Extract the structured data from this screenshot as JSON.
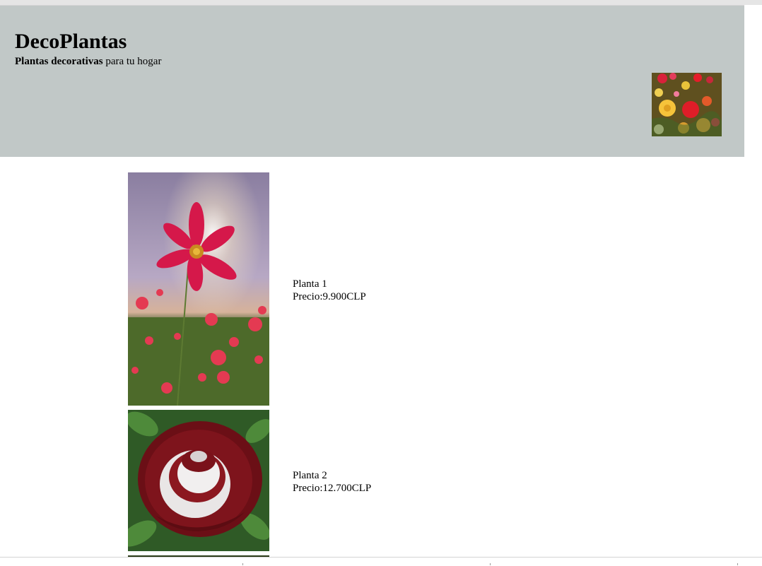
{
  "header": {
    "brand": "DecoPlantas",
    "tagline_bold": "Plantas decorativas",
    "tagline_rest": " para tu hogar",
    "image_icon": "mixed-flowers-photo"
  },
  "products": [
    {
      "name": "Planta 1",
      "price": "Precio:9.900CLP",
      "image_icon": "pink-cosmos-flower-photo"
    },
    {
      "name": "Planta 2",
      "price": "Precio:12.700CLP",
      "image_icon": "red-white-rose-photo"
    }
  ],
  "colors": {
    "header_bg": "#c1c8c7",
    "page_bg": "#ffffff"
  }
}
